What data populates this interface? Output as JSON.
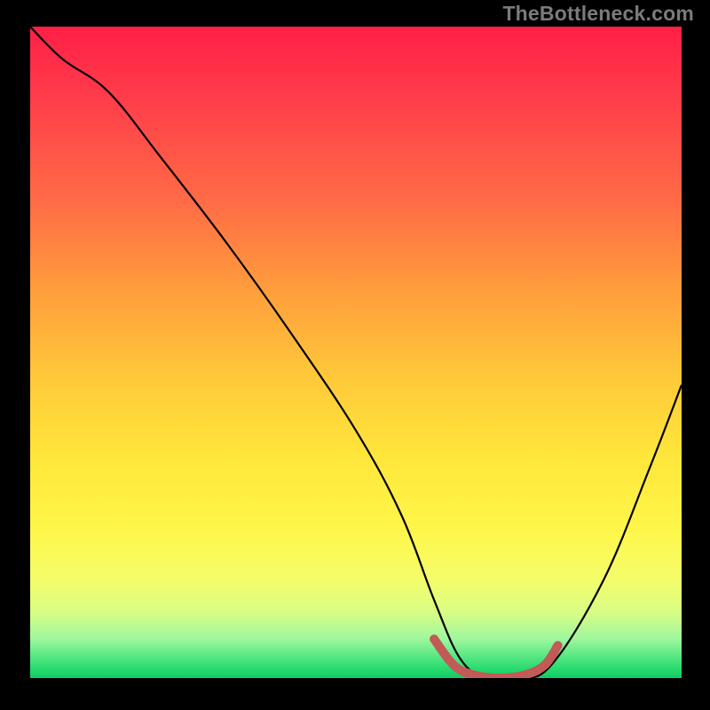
{
  "watermark": "TheBottleneck.com",
  "chart_data": {
    "type": "line",
    "title": "",
    "xlabel": "",
    "ylabel": "",
    "xlim": [
      0,
      100
    ],
    "ylim": [
      0,
      100
    ],
    "grid": false,
    "legend": null,
    "series": [
      {
        "name": "bottleneck-curve",
        "color": "#000000",
        "x": [
          0,
          5,
          12,
          20,
          30,
          40,
          50,
          57,
          62,
          66,
          70,
          75,
          80,
          88,
          95,
          100
        ],
        "y": [
          100,
          95,
          90,
          80,
          67,
          53,
          38,
          25,
          12,
          3,
          0,
          0,
          2,
          15,
          32,
          45
        ]
      },
      {
        "name": "optimal-range-marker",
        "color": "#c25a57",
        "x": [
          62,
          65,
          68,
          72,
          76,
          79,
          81
        ],
        "y": [
          6,
          2,
          0.5,
          0,
          0.5,
          2,
          5
        ]
      }
    ]
  },
  "colors": {
    "gradient_top": "#ff1f46",
    "gradient_bottom": "#16c962",
    "curve": "#000000",
    "optimal_marker": "#c25a57"
  }
}
